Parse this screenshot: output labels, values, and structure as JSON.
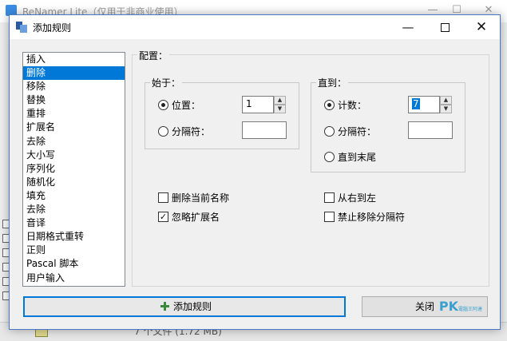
{
  "background_window": {
    "title": "ReNamer Lite（仅用于非商业使用）",
    "status_text": "7 个文件 (1.72 MB)"
  },
  "dialog": {
    "title": "添加规则",
    "controls": {
      "minimize": "—",
      "close": "✕"
    }
  },
  "rules": [
    {
      "label": "插入",
      "selected": false
    },
    {
      "label": "删除",
      "selected": true
    },
    {
      "label": "移除",
      "selected": false
    },
    {
      "label": "替换",
      "selected": false
    },
    {
      "label": "重排",
      "selected": false
    },
    {
      "label": "扩展名",
      "selected": false
    },
    {
      "label": "去除",
      "selected": false
    },
    {
      "label": "大小写",
      "selected": false
    },
    {
      "label": "序列化",
      "selected": false
    },
    {
      "label": "随机化",
      "selected": false
    },
    {
      "label": "填充",
      "selected": false
    },
    {
      "label": "去除",
      "selected": false
    },
    {
      "label": "音译",
      "selected": false
    },
    {
      "label": "日期格式重转",
      "selected": false
    },
    {
      "label": "正则",
      "selected": false
    },
    {
      "label": "Pascal 脚本",
      "selected": false
    },
    {
      "label": "用户输入",
      "selected": false
    }
  ],
  "config": {
    "label": "配置：",
    "from_group": {
      "label": "始于：",
      "position_label": "位置：",
      "position_value": "1",
      "delimiter_label": "分隔符：",
      "delimiter_value": "",
      "selected": "position"
    },
    "until_group": {
      "label": "直到：",
      "count_label": "计数：",
      "count_value": "7",
      "delimiter_label": "分隔符：",
      "delimiter_value": "",
      "till_end_label": "直到末尾",
      "selected": "count"
    },
    "options": {
      "delete_current_name": {
        "label": "删除当前名称",
        "checked": false
      },
      "ignore_extension": {
        "label": "忽略扩展名",
        "checked": true
      },
      "right_to_left": {
        "label": "从右到左",
        "checked": false
      },
      "no_remove_delimiters": {
        "label": "禁止移除分隔符",
        "checked": false
      }
    }
  },
  "buttons": {
    "add_rule": "添加规则",
    "close": "关闭"
  },
  "watermark": {
    "text": "PK",
    "subtext": "電腦王阿達"
  },
  "icons": {
    "add_rule_icon": "plus-icon",
    "dialog_icon": "rules-icon"
  }
}
